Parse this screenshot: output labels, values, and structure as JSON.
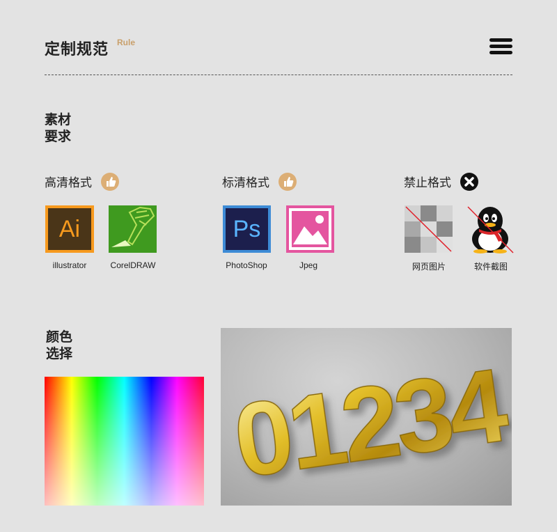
{
  "header": {
    "title": "定制规范",
    "subtitle": "Rule"
  },
  "section_material": {
    "title_line1": "素材",
    "title_line2": "要求"
  },
  "groups": [
    {
      "title": "高清格式",
      "badge": "thumbs-up",
      "items": [
        {
          "label": "illustrator",
          "icon": "ai-icon"
        },
        {
          "label": "CorelDRAW",
          "icon": "coreldraw-icon"
        }
      ]
    },
    {
      "title": "标清格式",
      "badge": "thumbs-up",
      "items": [
        {
          "label": "PhotoShop",
          "icon": "ps-icon"
        },
        {
          "label": "Jpeg",
          "icon": "jpeg-icon"
        }
      ]
    },
    {
      "title": "禁止格式",
      "badge": "x-mark",
      "items": [
        {
          "label": "网页图片",
          "icon": "web-image-icon"
        },
        {
          "label": "软件截图",
          "icon": "qq-screenshot-icon"
        }
      ]
    }
  ],
  "icon_text": {
    "ai": "Ai",
    "ps": "Ps"
  },
  "section_color": {
    "title_line1": "颜色",
    "title_line2": "选择"
  },
  "photo_text": "01234",
  "colors": {
    "accent": "#dcae75",
    "background": "#e3e3e3"
  }
}
